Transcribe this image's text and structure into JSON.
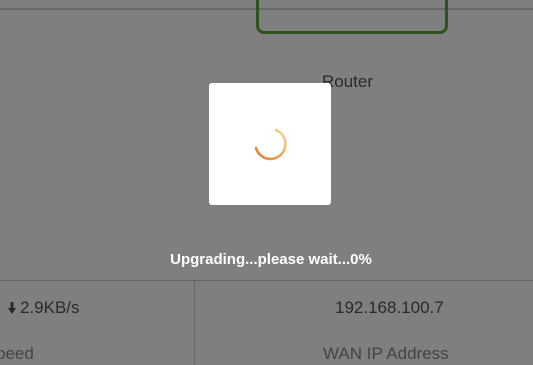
{
  "background": {
    "device_label": "Router",
    "download_speed": "2.9KB/s",
    "download_icon": "arrow-down-icon",
    "speed_label": "peed",
    "wan_ip": "192.168.100.7",
    "wan_ip_label": "WAN IP Address"
  },
  "modal": {
    "spinner_icon": "loading-spinner-icon",
    "status": "Upgrading...please wait...0%",
    "progress_percent": 0
  },
  "colors": {
    "router_border": "#5aa83a",
    "spinner_start": "#e07b2a",
    "spinner_end": "#f7c66a",
    "overlay": "rgba(0,0,0,0.5)"
  }
}
